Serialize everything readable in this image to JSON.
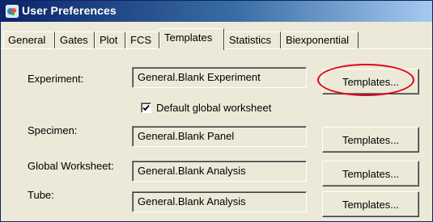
{
  "window": {
    "title": "User Preferences"
  },
  "tabs": [
    {
      "label": "General",
      "active": false
    },
    {
      "label": "Gates",
      "active": false
    },
    {
      "label": "Plot",
      "active": false
    },
    {
      "label": "FCS",
      "active": false
    },
    {
      "label": "Templates",
      "active": true
    },
    {
      "label": "Statistics",
      "active": false
    },
    {
      "label": "Biexponential",
      "active": false
    }
  ],
  "rows": [
    {
      "label": "Experiment:",
      "value": "General.Blank Experiment",
      "button": "Templates..."
    },
    {
      "label": "Specimen:",
      "value": "General.Blank Panel",
      "button": "Templates..."
    },
    {
      "label": "Global Worksheet:",
      "value": "General.Blank Analysis",
      "button": "Templates..."
    },
    {
      "label": "Tube:",
      "value": "General.Blank Analysis",
      "button": "Templates..."
    }
  ],
  "checkbox": {
    "label": "Default global worksheet",
    "checked": true
  },
  "colors": {
    "highlight": "#e2001a",
    "titlebar_start": "#0a246a",
    "titlebar_end": "#a6caf0",
    "window_bg": "#ece9d8"
  }
}
